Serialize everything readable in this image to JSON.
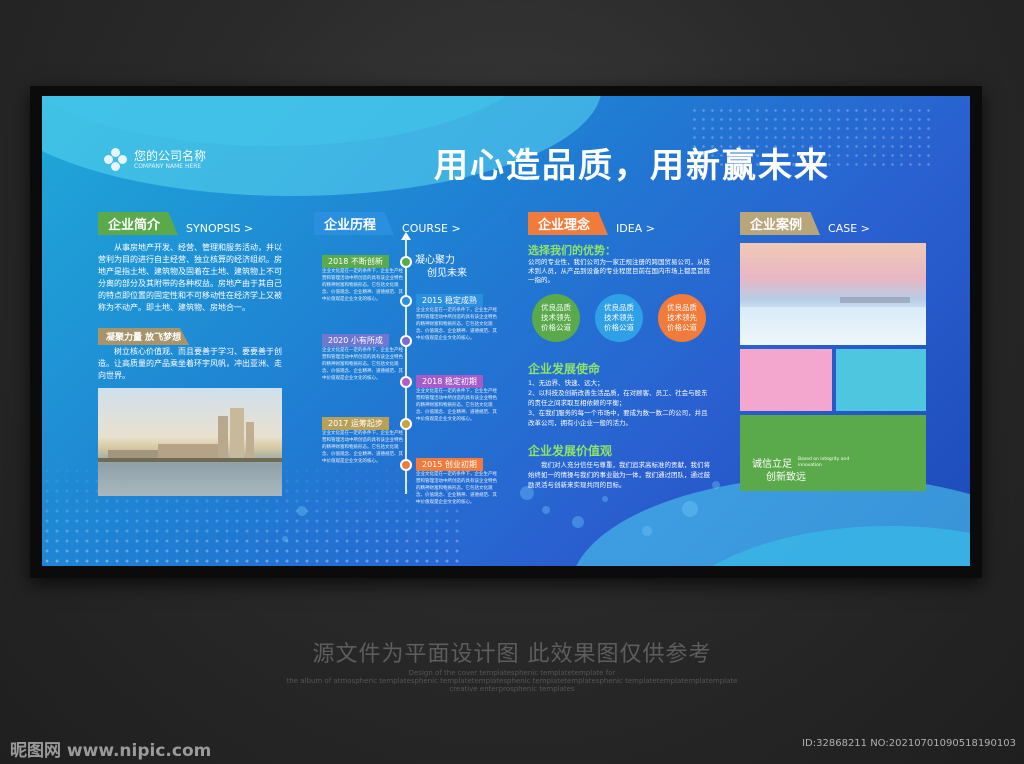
{
  "company": {
    "name": "您的公司名称",
    "sub": "COMPANY NAME HERE"
  },
  "headline": "用心造品质，用新赢未来",
  "synopsis": {
    "title_cn": "企业简介",
    "title_en": "SYNOPSIS >",
    "para1": "从事房地产开发、经营、管理和服务活动，并以营利为目的进行自主经营、独立核算的经济组织。房地产是指土地、建筑物及固着在土地、建筑物上不可分离的部分及其附带的各种权益。房地产由于其自己的特点即位置的固定性和不可移动性在经济学上又被称为不动产。即土地、建筑物、房地合一。",
    "tag": "凝聚力量 放飞梦想",
    "para2": "树立核心价值观、而且要善于学习、要要善于创造。让高质量的产品乘坐着环宇风帆，冲出亚洲、走向世界。"
  },
  "course": {
    "title_cn": "企业历程",
    "title_en": "COURSE >",
    "slogan1": "凝心聚力",
    "slogan2": "创见未来",
    "items": [
      {
        "year": "2018 不断创新",
        "text": "企业文化是在一定的条件下，企业生产经营和管理活动中所创造的具有该企业特色的精神财富和物质形态。它包括文化观念、价值观念、企业精神、道德规范、其中价值观是企业文化的核心。"
      },
      {
        "year": "2015 稳定成熟",
        "text": "企业文化是在一定的条件下，企业生产经营和管理活动中所创造的具有该企业特色的精神财富和物质形态。它包括文化观念、价值观念、企业精神、道德规范、其中价值观是企业文化的核心。"
      },
      {
        "year": "2020 小有所成",
        "text": "企业文化是在一定的条件下，企业生产经营和管理活动中所创造的具有该企业特色的精神财富和物质形态。它包括文化观念、价值观念、企业精神、道德规范、其中价值观是企业文化的核心。"
      },
      {
        "year": "2018 稳定初期",
        "text": "企业文化是在一定的条件下，企业生产经营和管理活动中所创造的具有该企业特色的精神财富和物质形态。它包括文化观念、价值观念、企业精神、道德规范、其中价值观是企业文化的核心。"
      },
      {
        "year": "2017 运筹起步",
        "text": "企业文化是在一定的条件下，企业生产经营和管理活动中所创造的具有该企业特色的精神财富和物质形态。它包括文化观念、价值观念、企业精神、道德规范、其中价值观是企业文化的核心。"
      },
      {
        "year": "2015 创业初期",
        "text": "企业文化是在一定的条件下，企业生产经营和管理活动中所创造的具有该企业特色的精神财富和物质形态。它包括文化观念、价值观念、企业精神、道德规范、其中价值观是企业文化的核心。"
      }
    ]
  },
  "idea": {
    "title_cn": "企业理念",
    "title_en": "IDEA >",
    "adv_title": "选择我们的优势：",
    "adv_text": "公司的专业性，我们公司为一家正规注册的跨国贸易公司，从技术到人员，从产品到设备的专业程度目前在国内市场上都是首屈一指的。",
    "circles": [
      "优良品质技术领先价格公道",
      "优良品质技术领先价格公道",
      "优良品质技术领先价格公道"
    ],
    "mission_title": "企业发展使命",
    "mission": [
      "1、无边界、快速、远大；",
      "2、以科技及创新改善生活品质，在对顾客、员工、社会与股东的责任之间求取互相依赖的平衡；",
      "3、在我们服务的每一个市场中，要成为数一数二的公司，并且改革公司，拥有小企业一般的活力。"
    ],
    "value_title": "企业发展价值观",
    "value_text": "我们对人充分信任与尊重，我们追求高标准的贡献，我们将始终如一的情操与我们的事业融为一体，我们通过团队，通过鼓励灵活与创新来实现共同的目标。"
  },
  "case": {
    "title_cn": "企业案例",
    "title_en": "CASE >",
    "slogan1": "诚信立足",
    "slogan2": "创新致远",
    "slogan_en": "Based on integrity and innovation"
  },
  "footer": {
    "main": "源文件为平面设计图 此效果图仅供参考",
    "small1": "Design of the cover templatesphenic templatetemplate for",
    "small2": "the album of atmospheric templatesphenic templatetemplatesphenic templatetemplatesphenic templatetemplatemplatemplate",
    "small3": "creative enterprosphenic templates",
    "watermark": "昵图网 www.nipic.com",
    "id": "ID:32868211 NO:20210701090518190103"
  },
  "colors": {
    "green": "#5aa94b",
    "blue": "#2b8fe0",
    "orange": "#f07b3a",
    "tan": "#b9a57a"
  }
}
